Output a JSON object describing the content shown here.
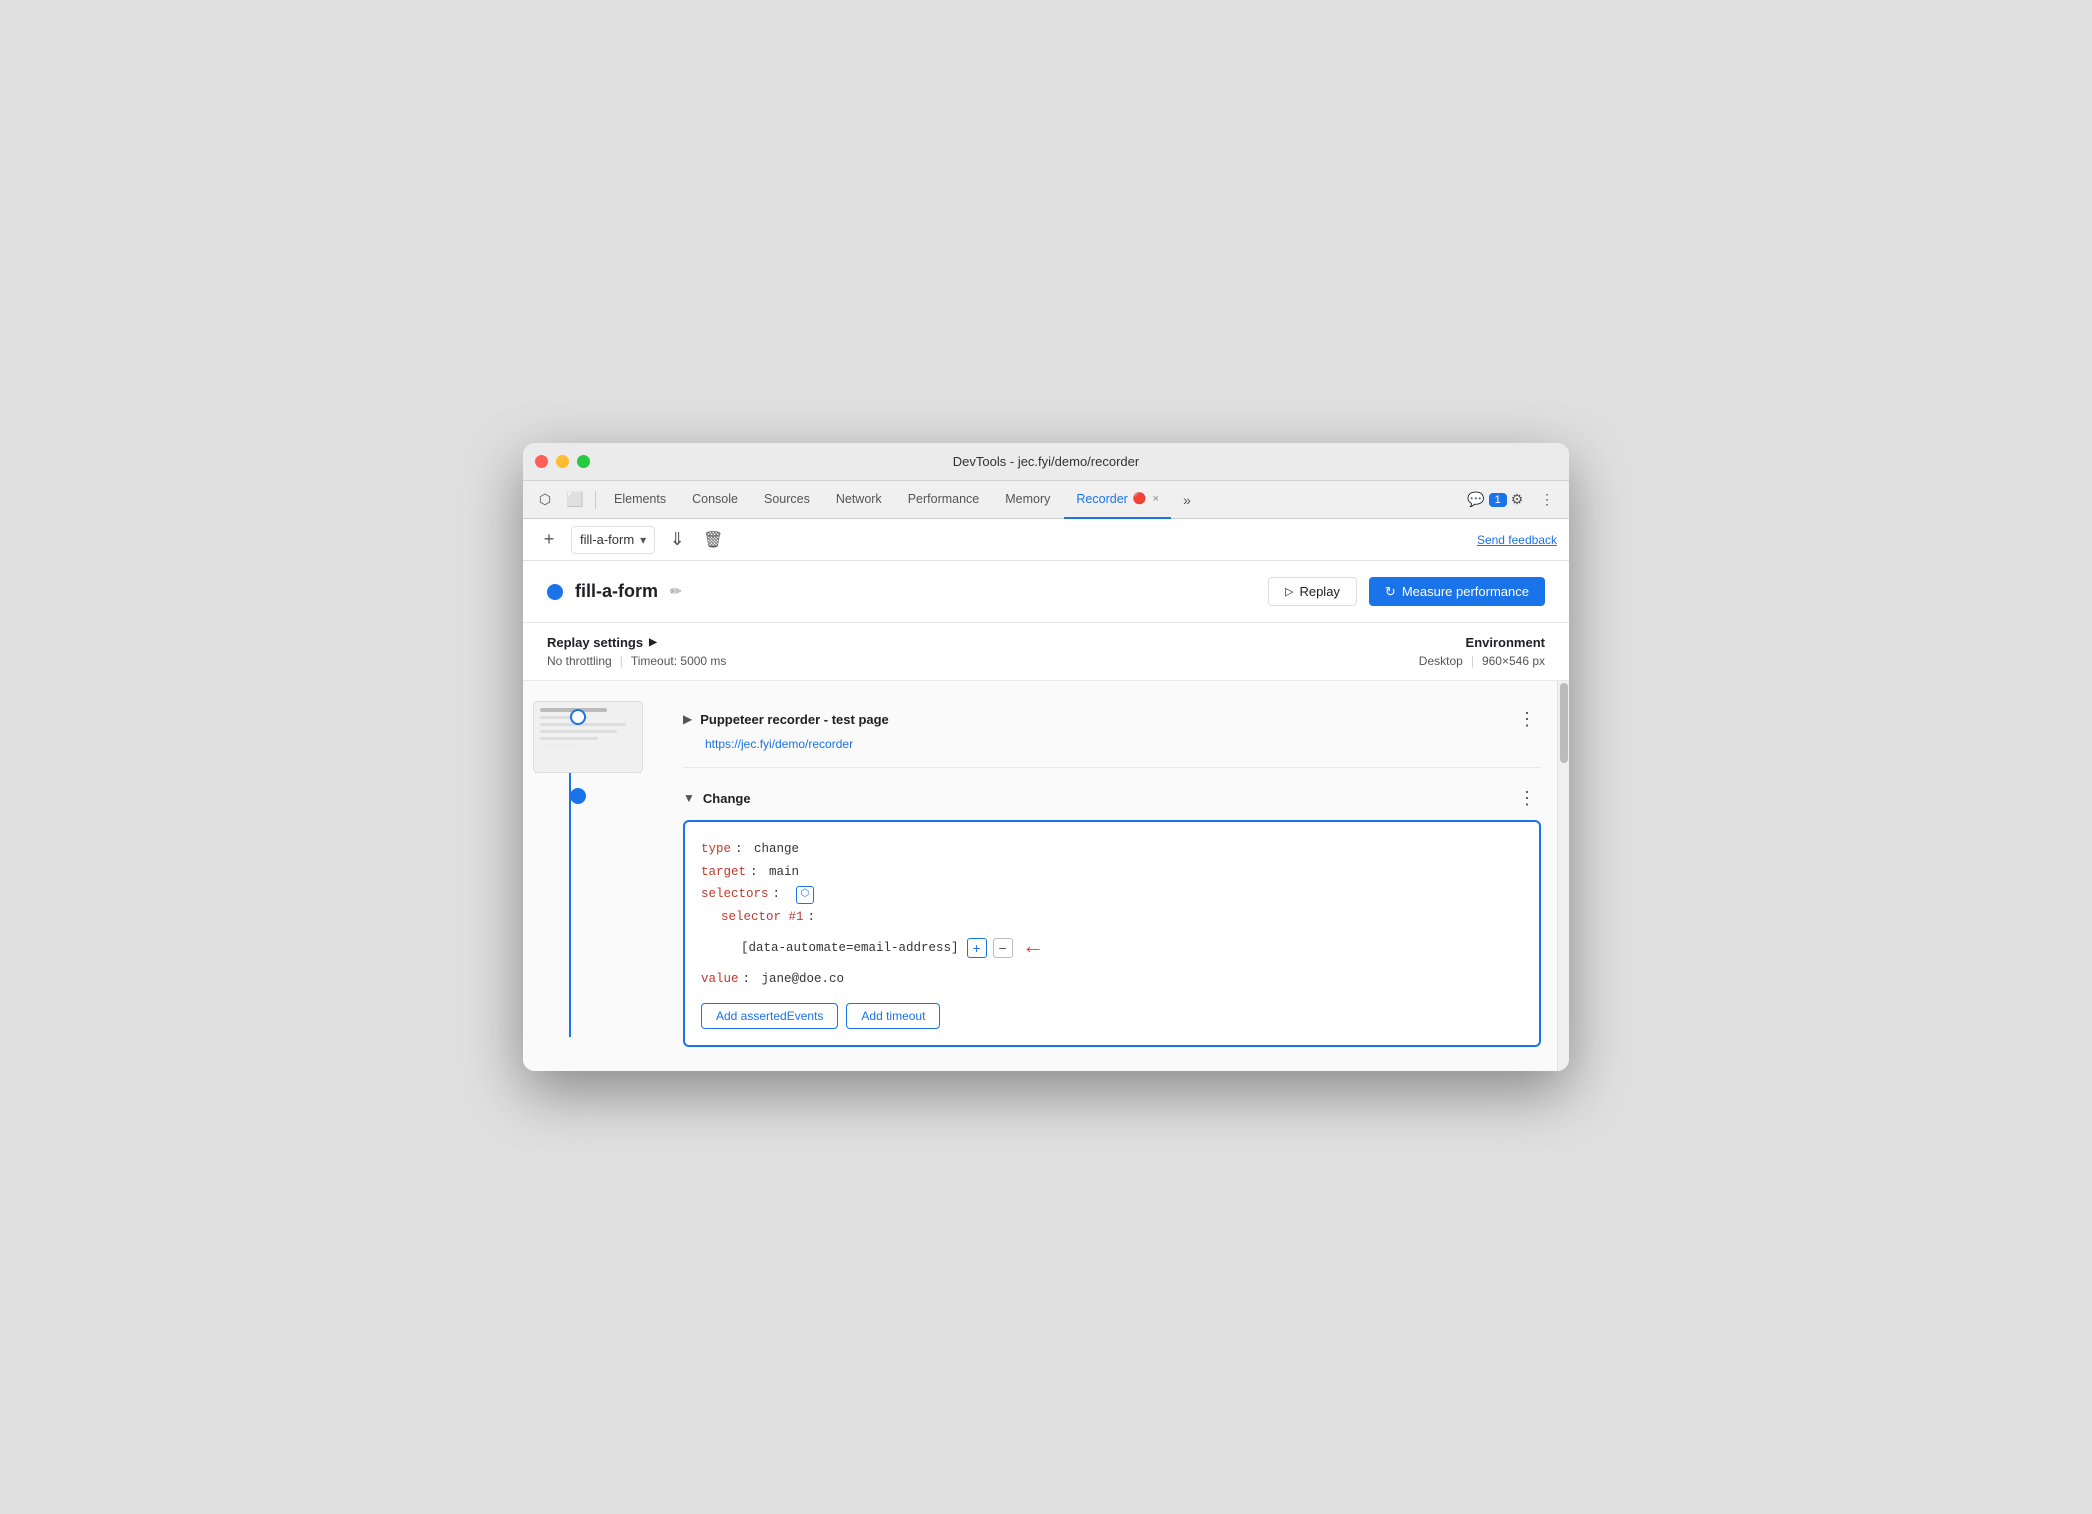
{
  "window": {
    "title": "DevTools - jec.fyi/demo/recorder"
  },
  "tabs": {
    "items": [
      {
        "label": "Elements",
        "active": false
      },
      {
        "label": "Console",
        "active": false
      },
      {
        "label": "Sources",
        "active": false
      },
      {
        "label": "Network",
        "active": false
      },
      {
        "label": "Performance",
        "active": false
      },
      {
        "label": "Memory",
        "active": false
      },
      {
        "label": "Recorder",
        "active": true
      }
    ],
    "recorder_close": "×",
    "more_tabs": "»",
    "chat_badge": "1",
    "gear_icon": "⚙",
    "more_icon": "⋮"
  },
  "toolbar": {
    "add_icon": "+",
    "recording_name": "fill-a-form",
    "dropdown_icon": "▾",
    "export_icon": "↓",
    "delete_icon": "🗑",
    "send_feedback": "Send feedback"
  },
  "recording": {
    "dot_color": "#1a73e8",
    "name": "fill-a-form",
    "edit_icon": "✏",
    "replay_label": "Replay",
    "measure_label": "Measure performance"
  },
  "settings": {
    "title": "Replay settings",
    "expand_icon": "▶",
    "throttle": "No throttling",
    "timeout": "Timeout: 5000 ms",
    "env_title": "Environment",
    "desktop": "Desktop",
    "viewport": "960×546 px"
  },
  "steps": [
    {
      "type": "navigate",
      "title": "Puppeteer recorder - test page",
      "url": "https://jec.fyi/demo/recorder",
      "expanded": false,
      "has_thumbnail": true
    },
    {
      "type": "change",
      "title": "Change",
      "expanded": true,
      "code": {
        "type_key": "type",
        "type_val": "change",
        "target_key": "target",
        "target_val": "main",
        "selectors_key": "selectors",
        "selector_num_key": "selector #1",
        "selector_val": "[data-automate=email-address]",
        "value_key": "value",
        "value_val": "jane@doe.co"
      },
      "add_asserted_label": "Add assertedEvents",
      "add_timeout_label": "Add timeout"
    }
  ],
  "colors": {
    "blue": "#1a73e8",
    "red": "#e53935",
    "code_key_red": "#c0392b"
  }
}
